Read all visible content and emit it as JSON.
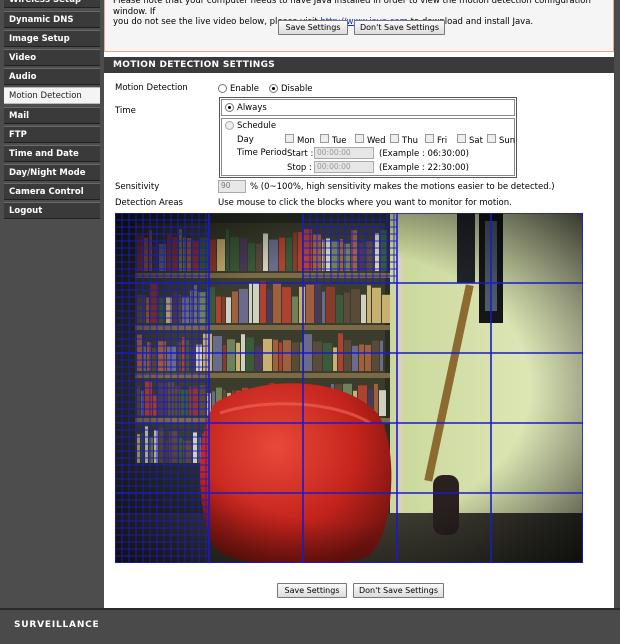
{
  "sidebar": {
    "items": [
      {
        "label": "Wireless Setup",
        "active": false
      },
      {
        "label": "Dynamic DNS",
        "active": false
      },
      {
        "label": "Image Setup",
        "active": false
      },
      {
        "label": "Video",
        "active": false
      },
      {
        "label": "Audio",
        "active": false
      },
      {
        "label": "Motion Detection",
        "active": true
      },
      {
        "label": "Mail",
        "active": false
      },
      {
        "label": "FTP",
        "active": false
      },
      {
        "label": "Time and Date",
        "active": false
      },
      {
        "label": "Day/Night Mode",
        "active": false
      },
      {
        "label": "Camera Control",
        "active": false
      },
      {
        "label": "Logout",
        "active": false
      }
    ]
  },
  "java_note": {
    "line1": "Please note that your computer needs to have Java installed in order to view the motion detection configuration window. If",
    "line2_pre": "you do not see the live video below, please visit ",
    "link": "http://www.java.com",
    "line2_post": " to download and install Java."
  },
  "buttons": {
    "save": "Save Settings",
    "dont_save": "Don't Save Settings"
  },
  "section": {
    "title": "MOTION DETECTION SETTINGS"
  },
  "form": {
    "motion_detection_label": "Motion Detection",
    "enable_label": "Enable",
    "disable_label": "Disable",
    "selected": "Disable",
    "time_label": "Time",
    "always_label": "Always",
    "schedule_label": "Schedule",
    "time_mode": "Always",
    "day_label": "Day",
    "days": [
      "Mon",
      "Tue",
      "Wed",
      "Thu",
      "Fri",
      "Sat",
      "Sun"
    ],
    "time_period_label": "Time Period",
    "start_label": "Start :",
    "start_value": "00:00:00",
    "start_example": "(Example : 06:30:00)",
    "stop_label": "Stop :",
    "stop_value": "00:00:00",
    "stop_example": "(Example : 22:30:00)",
    "sensitivity_label": "Sensitivity",
    "sensitivity_value": "90",
    "sensitivity_hint": "% (0~100%, high sensitivity makes the motions easier to be detected.)",
    "detection_areas_label": "Detection Areas",
    "detection_areas_hint": "Use mouse to click the blocks where you want to monitor for motion."
  },
  "detection_grid": {
    "columns": 5,
    "rows": 5,
    "line_color": "#1a1acc",
    "selected_blocks": [
      {
        "row": 0,
        "col": 0
      },
      {
        "row": 0,
        "col": 2
      },
      {
        "row": 1,
        "col": 0
      },
      {
        "row": 2,
        "col": 0
      },
      {
        "row": 3,
        "col": 0
      },
      {
        "row": 4,
        "col": 0
      }
    ]
  },
  "footer": {
    "brand": "SURVEILLANCE"
  },
  "colors": {
    "sidebar_bg": "#3a3a3a",
    "section_bar": "#3a3a3a",
    "link": "#1030c0",
    "note_border": "#e8a98a"
  }
}
